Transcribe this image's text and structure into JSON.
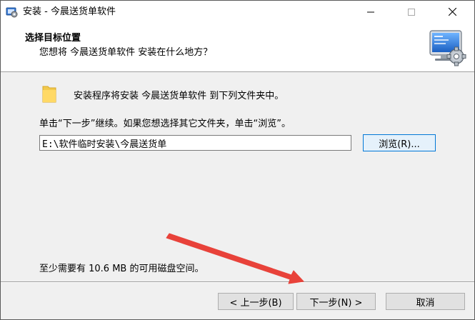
{
  "window": {
    "title": "安装 - 今晨送货单软件"
  },
  "header": {
    "title": "选择目标位置",
    "subtitle": "您想将 今晨送货单软件 安装在什么地方？"
  },
  "body": {
    "intro": "安装程序将安装 今晨送货单软件 到下列文件夹中。",
    "instruction": "单击“下一步”继续。如果您想选择其它文件夹，单击“浏览”。",
    "path_value": "E:\\软件临时安装\\今晨送货单",
    "browse_label": "浏览(R)...",
    "space_note": "至少需要有 10.6 MB 的可用磁盘空间。"
  },
  "footer": {
    "back_label": "< 上一步(B)",
    "next_label": "下一步(N) >",
    "cancel_label": "取消"
  },
  "colors": {
    "annotation_arrow": "#e8423a",
    "focus_border": "#0078d7"
  },
  "icons": {
    "app": "installer-icon",
    "folder": "folder-icon",
    "logo": "computer-gear-icon"
  }
}
